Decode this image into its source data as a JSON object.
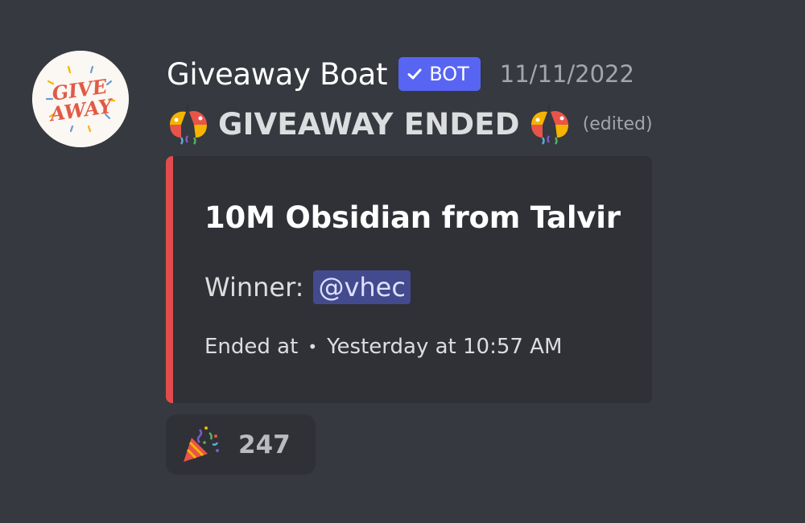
{
  "message": {
    "author": "Giveaway Boat",
    "bot_tag": "BOT",
    "timestamp": "11/11/2022",
    "content": "GIVEAWAY ENDED",
    "edited": "(edited)",
    "avatar_text": [
      "GIVE",
      "AWAY"
    ],
    "icons": {
      "avatar": "giveaway-logo",
      "bot_check": "check-icon",
      "content_emoji": "tada-celebration-icon",
      "reaction_emoji": "party-popper-icon"
    }
  },
  "embed": {
    "accent_color": "#e34c4c",
    "title": "10M Obsidian from Talvir",
    "winner_label": "Winner:",
    "winner_mention": "@vhec",
    "ended_label": "Ended at",
    "ended_time": "Yesterday at 10:57 AM"
  },
  "reaction": {
    "count": "247"
  },
  "colors": {
    "background": "#36393f",
    "embed_background": "#2f3136",
    "blurple": "#5865f2"
  }
}
